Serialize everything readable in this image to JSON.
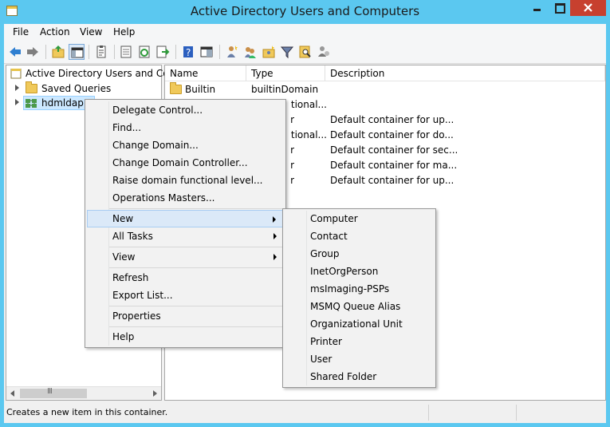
{
  "window": {
    "title": "Active Directory Users and Computers"
  },
  "menu": [
    "File",
    "Action",
    "View",
    "Help"
  ],
  "toolbar": {
    "buttons": [
      "back-icon",
      "forward-icon",
      "up-folder-icon",
      "console-tree-icon",
      "clipboard-icon",
      "export-list-icon",
      "refresh-icon",
      "export-icon",
      "help-icon",
      "properties-pane-icon",
      "new-user-icon",
      "new-group-icon",
      "new-ou-icon",
      "filter-icon",
      "find-icon",
      "add-to-group-icon"
    ]
  },
  "tree": {
    "root": "Active Directory Users and Com",
    "items": [
      {
        "label": "Saved Queries"
      },
      {
        "label": "hdmldap.c"
      }
    ],
    "scroll_thumb": "III"
  },
  "list": {
    "columns": [
      "Name",
      "Type",
      "Description"
    ],
    "rows": [
      {
        "name": "Builtin",
        "type": "builtinDomain",
        "description": ""
      },
      {
        "name": "",
        "type": "tional...",
        "description": ""
      },
      {
        "name": "",
        "type": "r",
        "description": "Default container for up..."
      },
      {
        "name": "",
        "type": "tional...",
        "description": "Default container for do..."
      },
      {
        "name": "",
        "type": "r",
        "description": "Default container for sec..."
      },
      {
        "name": "",
        "type": "r",
        "description": "Default container for ma..."
      },
      {
        "name": "",
        "type": "r",
        "description": "Default container for up..."
      }
    ]
  },
  "context_menu": {
    "items": [
      {
        "label": "Delegate Control..."
      },
      {
        "label": "Find..."
      },
      {
        "label": "Change Domain..."
      },
      {
        "label": "Change Domain Controller..."
      },
      {
        "label": "Raise domain functional level..."
      },
      {
        "label": "Operations Masters..."
      },
      {
        "label": "New"
      },
      {
        "label": "All Tasks"
      },
      {
        "label": "View"
      },
      {
        "label": "Refresh"
      },
      {
        "label": "Export List..."
      },
      {
        "label": "Properties"
      },
      {
        "label": "Help"
      }
    ]
  },
  "submenu": {
    "items": [
      "Computer",
      "Contact",
      "Group",
      "InetOrgPerson",
      "msImaging-PSPs",
      "MSMQ Queue Alias",
      "Organizational Unit",
      "Printer",
      "User",
      "Shared Folder"
    ]
  },
  "status": {
    "text": "Creates a new item in this container."
  },
  "colors": {
    "titlebar": "#5bc8f0",
    "close_button": "#c7402f",
    "menu_highlight": "#dbe9f8",
    "folder": "#f0c95a"
  }
}
